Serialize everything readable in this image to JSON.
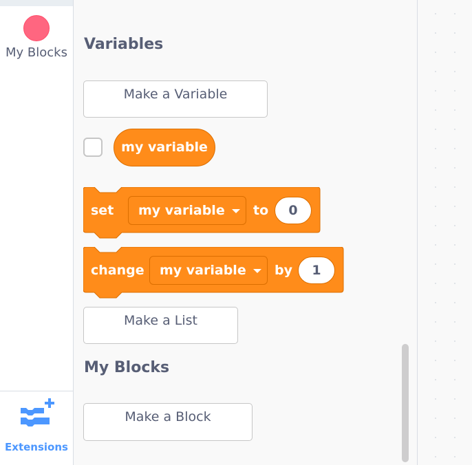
{
  "categories": {
    "my_blocks_label": "My Blocks",
    "my_blocks_color": "#ff6680",
    "extensions_label": "Extensions",
    "extensions_color": "#4c97ff"
  },
  "flyout": {
    "variables_heading": "Variables",
    "make_variable_label": "Make a Variable",
    "variable_reporter_label": "my variable",
    "variable_color": "#ff8c1a",
    "set_block": {
      "keyword": "set",
      "dropdown_value": "my variable",
      "connector": "to",
      "input_value": "0"
    },
    "change_block": {
      "keyword": "change",
      "dropdown_value": "my variable",
      "connector": "by",
      "input_value": "1"
    },
    "make_list_label": "Make a List",
    "my_blocks_heading": "My Blocks",
    "make_block_label": "Make a Block"
  }
}
